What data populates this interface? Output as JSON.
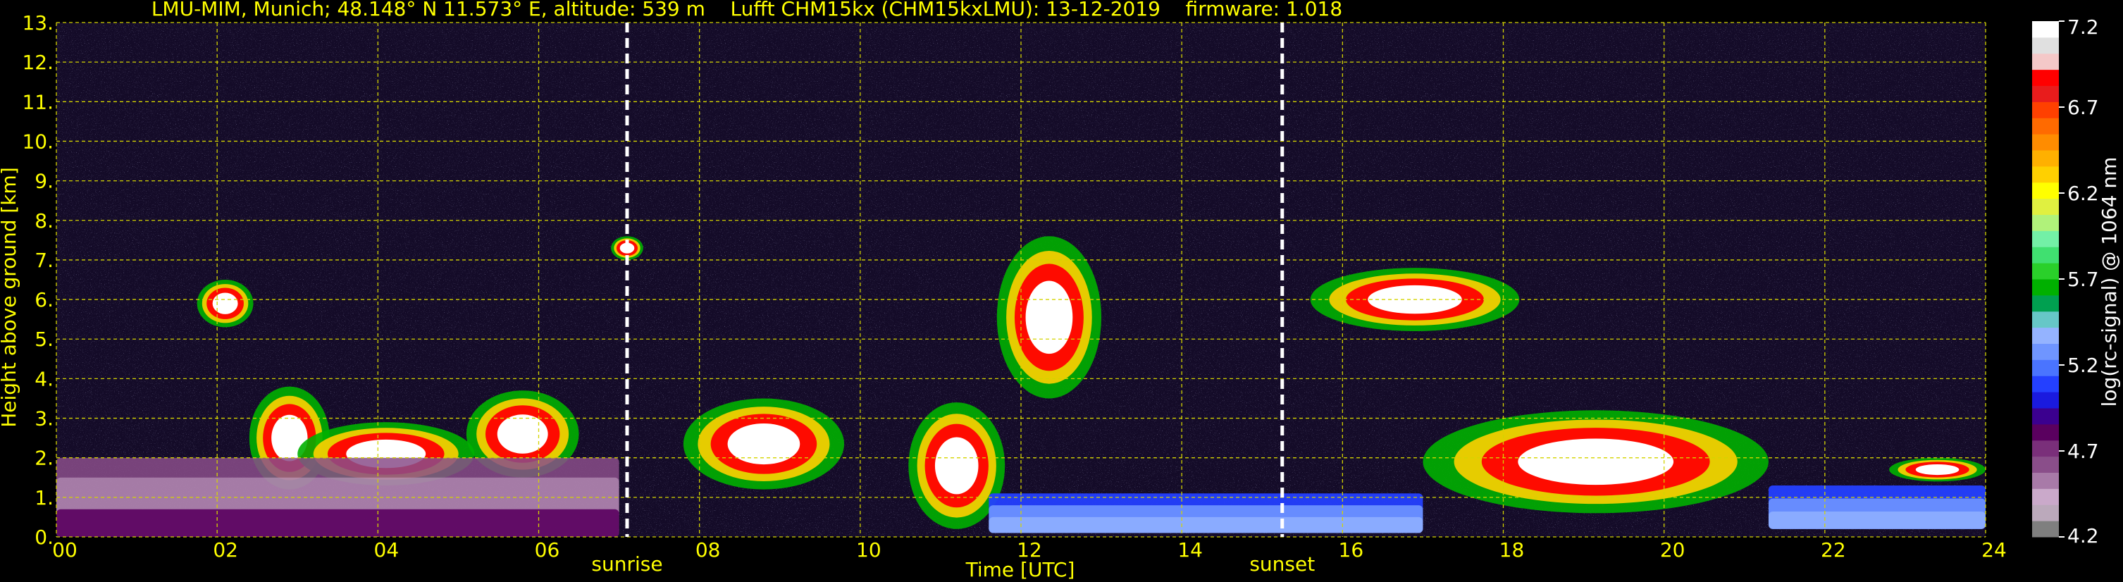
{
  "chart_data": {
    "type": "heatmap",
    "title": "LMU-MIM, Munich; 48.148° N 11.573° E, altitude: 539 m    Lufft CHM15kx (CHM15kxLMU): 13-12-2019    firmware: 1.018",
    "xlabel": "Time [UTC]",
    "ylabel": "Height above ground [km]",
    "xlim": [
      0,
      24
    ],
    "ylim": [
      0,
      13
    ],
    "x_ticks": [
      "00",
      "02",
      "04",
      "06",
      "08",
      "10",
      "12",
      "14",
      "16",
      "18",
      "20",
      "22",
      "24"
    ],
    "y_ticks": [
      "0.",
      "1.",
      "2.",
      "3.",
      "4.",
      "5.",
      "6.",
      "7.",
      "8.",
      "9.",
      "10.",
      "11.",
      "12.",
      "13."
    ],
    "grid": true,
    "markers": [
      {
        "label": "sunrise",
        "x": 7.1
      },
      {
        "label": "sunset",
        "x": 15.25
      }
    ],
    "colorbar": {
      "label": "log(rc-signal) @ 1064 nm",
      "range": [
        4.2,
        7.2
      ],
      "ticks": [
        "4.2",
        "4.7",
        "5.2",
        "5.7",
        "6.2",
        "6.7",
        "7.2"
      ],
      "colors": [
        "#7f7f7f",
        "#bba9bb",
        "#caa9ca",
        "#a87aa8",
        "#8a4e8a",
        "#7a2f7a",
        "#5a005f",
        "#3b008f",
        "#1a1adf",
        "#2440ff",
        "#4a74ff",
        "#6f95ff",
        "#94b3ff",
        "#66c7c7",
        "#00a050",
        "#00b000",
        "#2ad02a",
        "#40e070",
        "#73f0a6",
        "#b0f27a",
        "#e0f040",
        "#ffff00",
        "#ffd000",
        "#ffb000",
        "#ff8c00",
        "#ff6a00",
        "#ff4000",
        "#e81c1c",
        "#ff0000",
        "#f4c8c8",
        "#e0e0e0",
        "#ffffff"
      ]
    },
    "features": [
      {
        "label": "",
        "x": [
          1.75,
          2.45
        ],
        "y": [
          5.3,
          6.5
        ],
        "kind": "cloud"
      },
      {
        "label": "",
        "x": [
          2.4,
          3.4
        ],
        "y": [
          1.2,
          3.8
        ],
        "kind": "cloud"
      },
      {
        "label": "",
        "x": [
          3.0,
          5.2
        ],
        "y": [
          1.3,
          2.9
        ],
        "kind": "cloud"
      },
      {
        "label": "",
        "x": [
          5.1,
          6.5
        ],
        "y": [
          1.5,
          3.7
        ],
        "kind": "cloud"
      },
      {
        "label": "",
        "x": [
          6.9,
          7.3
        ],
        "y": [
          7.0,
          7.6
        ],
        "kind": "cloud"
      },
      {
        "label": "",
        "x": [
          7.8,
          9.8
        ],
        "y": [
          1.2,
          3.5
        ],
        "kind": "cloud"
      },
      {
        "label": "",
        "x": [
          10.6,
          11.8
        ],
        "y": [
          0.2,
          3.4
        ],
        "kind": "cloud"
      },
      {
        "label": "",
        "x": [
          11.7,
          13.0
        ],
        "y": [
          3.5,
          7.6
        ],
        "kind": "cloud"
      },
      {
        "label": "",
        "x": [
          15.6,
          18.2
        ],
        "y": [
          5.2,
          6.8
        ],
        "kind": "cloud"
      },
      {
        "label": "",
        "x": [
          17.0,
          21.3
        ],
        "y": [
          0.6,
          3.2
        ],
        "kind": "cloud"
      },
      {
        "label": "",
        "x": [
          22.8,
          24.0
        ],
        "y": [
          1.4,
          2.0
        ],
        "kind": "cloud"
      },
      {
        "label": "",
        "x": [
          11.6,
          17.0
        ],
        "y": [
          0.1,
          1.1
        ],
        "kind": "aerosol"
      },
      {
        "label": "",
        "x": [
          21.3,
          24.0
        ],
        "y": [
          0.2,
          1.3
        ],
        "kind": "aerosol"
      },
      {
        "label": "",
        "x": [
          0.0,
          7.0
        ],
        "y": [
          0.0,
          2.0
        ],
        "kind": "boundary-layer"
      }
    ]
  }
}
